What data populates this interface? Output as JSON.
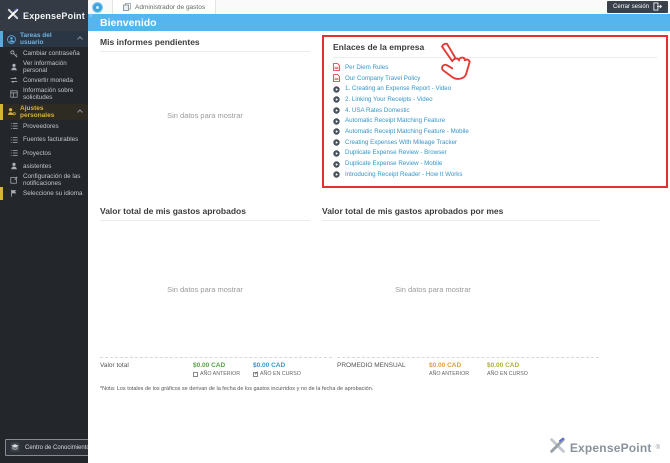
{
  "topbar": {
    "logo_text": "ExpensePoint",
    "logo_reg": "®",
    "tab_label": "Administrador de gastos",
    "logout_label": "Cerrar sesión"
  },
  "header": {
    "title": "Bienvenido"
  },
  "sidebar": {
    "sections": [
      {
        "label": "Tareas del usuario",
        "items": [
          "Cambiar contraseña",
          "Ver información personal",
          "Convertir moneda",
          "Información sobre solicitudes"
        ]
      },
      {
        "label": "Ajustes personales",
        "items": [
          "Proveedores",
          "Fuentes facturables",
          "Proyectos",
          "asistentes",
          "Configuración de las notificaciones",
          "Seleccione su idioma"
        ]
      }
    ],
    "knowledge_center": "Centro de Conocimiento"
  },
  "main": {
    "pending_reports": {
      "title": "Mis informes pendientes",
      "empty": "Sin datos para mostrar"
    },
    "company_links": {
      "title": "Enlaces de la empresa",
      "links": [
        {
          "icon": "pdf-icon",
          "label": "Per Diem Rules"
        },
        {
          "icon": "pdf-icon",
          "label": "Our Company Travel Policy"
        },
        {
          "icon": "video-icon",
          "label": "1. Creating an Expense Report - Video"
        },
        {
          "icon": "video-icon",
          "label": "2. Linking Your Receipts - Video"
        },
        {
          "icon": "video-icon",
          "label": "4. USA Rates Domestic"
        },
        {
          "icon": "video-icon",
          "label": "Automatic Receipt Matching Feature"
        },
        {
          "icon": "video-icon",
          "label": "Automatic Receipt Matching Feature - Mobile"
        },
        {
          "icon": "video-icon",
          "label": "Creating Expenses With Mileage Tracker"
        },
        {
          "icon": "video-icon",
          "label": "Duplicate Expense Review - Browser"
        },
        {
          "icon": "video-icon",
          "label": "Duplicate Expense Review - Mobile"
        },
        {
          "icon": "video-icon",
          "label": "Introducing Receipt Reader - How It Works"
        }
      ]
    },
    "approved_total": {
      "title": "Valor total de mis gastos aprobados",
      "empty": "Sin datos para mostrar"
    },
    "approved_monthly": {
      "title": "Valor total de mis gastos aprobados por mes",
      "empty": "Sin datos para mostrar"
    },
    "totals": {
      "label": "Valor total",
      "prev": {
        "value": "$0.00 CAD",
        "label": "AÑO ANTERIOR",
        "checked": false
      },
      "curr": {
        "value": "$0.00 CAD",
        "label": "AÑO EN CURSO",
        "checked": true
      }
    },
    "monthly_avg": {
      "label": "PROMEDIO MENSUAL",
      "prev": {
        "value": "$0.00 CAD",
        "label": "AÑO ANTERIOR"
      },
      "curr": {
        "value": "$0.00 CAD",
        "label": "AÑO EN CURSO"
      }
    },
    "footnote": "*Nota: Los totales de los gráficos se derivan de la fecha de los gastos incurridos y no de la fecha de aprobación.",
    "footer_logo_text": "ExpensePoint",
    "footer_logo_reg": "®"
  },
  "colors": {
    "header_blue": "#54b5ef",
    "alert_red": "#e23131",
    "link_blue": "#3596c8",
    "value_green": "#55a545",
    "value_blue": "#3596c8",
    "value_orange": "#df9f35",
    "value_olive": "#adb32b",
    "sidebar_accent_blue": "#5ba9dd",
    "sidebar_accent_yellow": "#d9b13b"
  }
}
